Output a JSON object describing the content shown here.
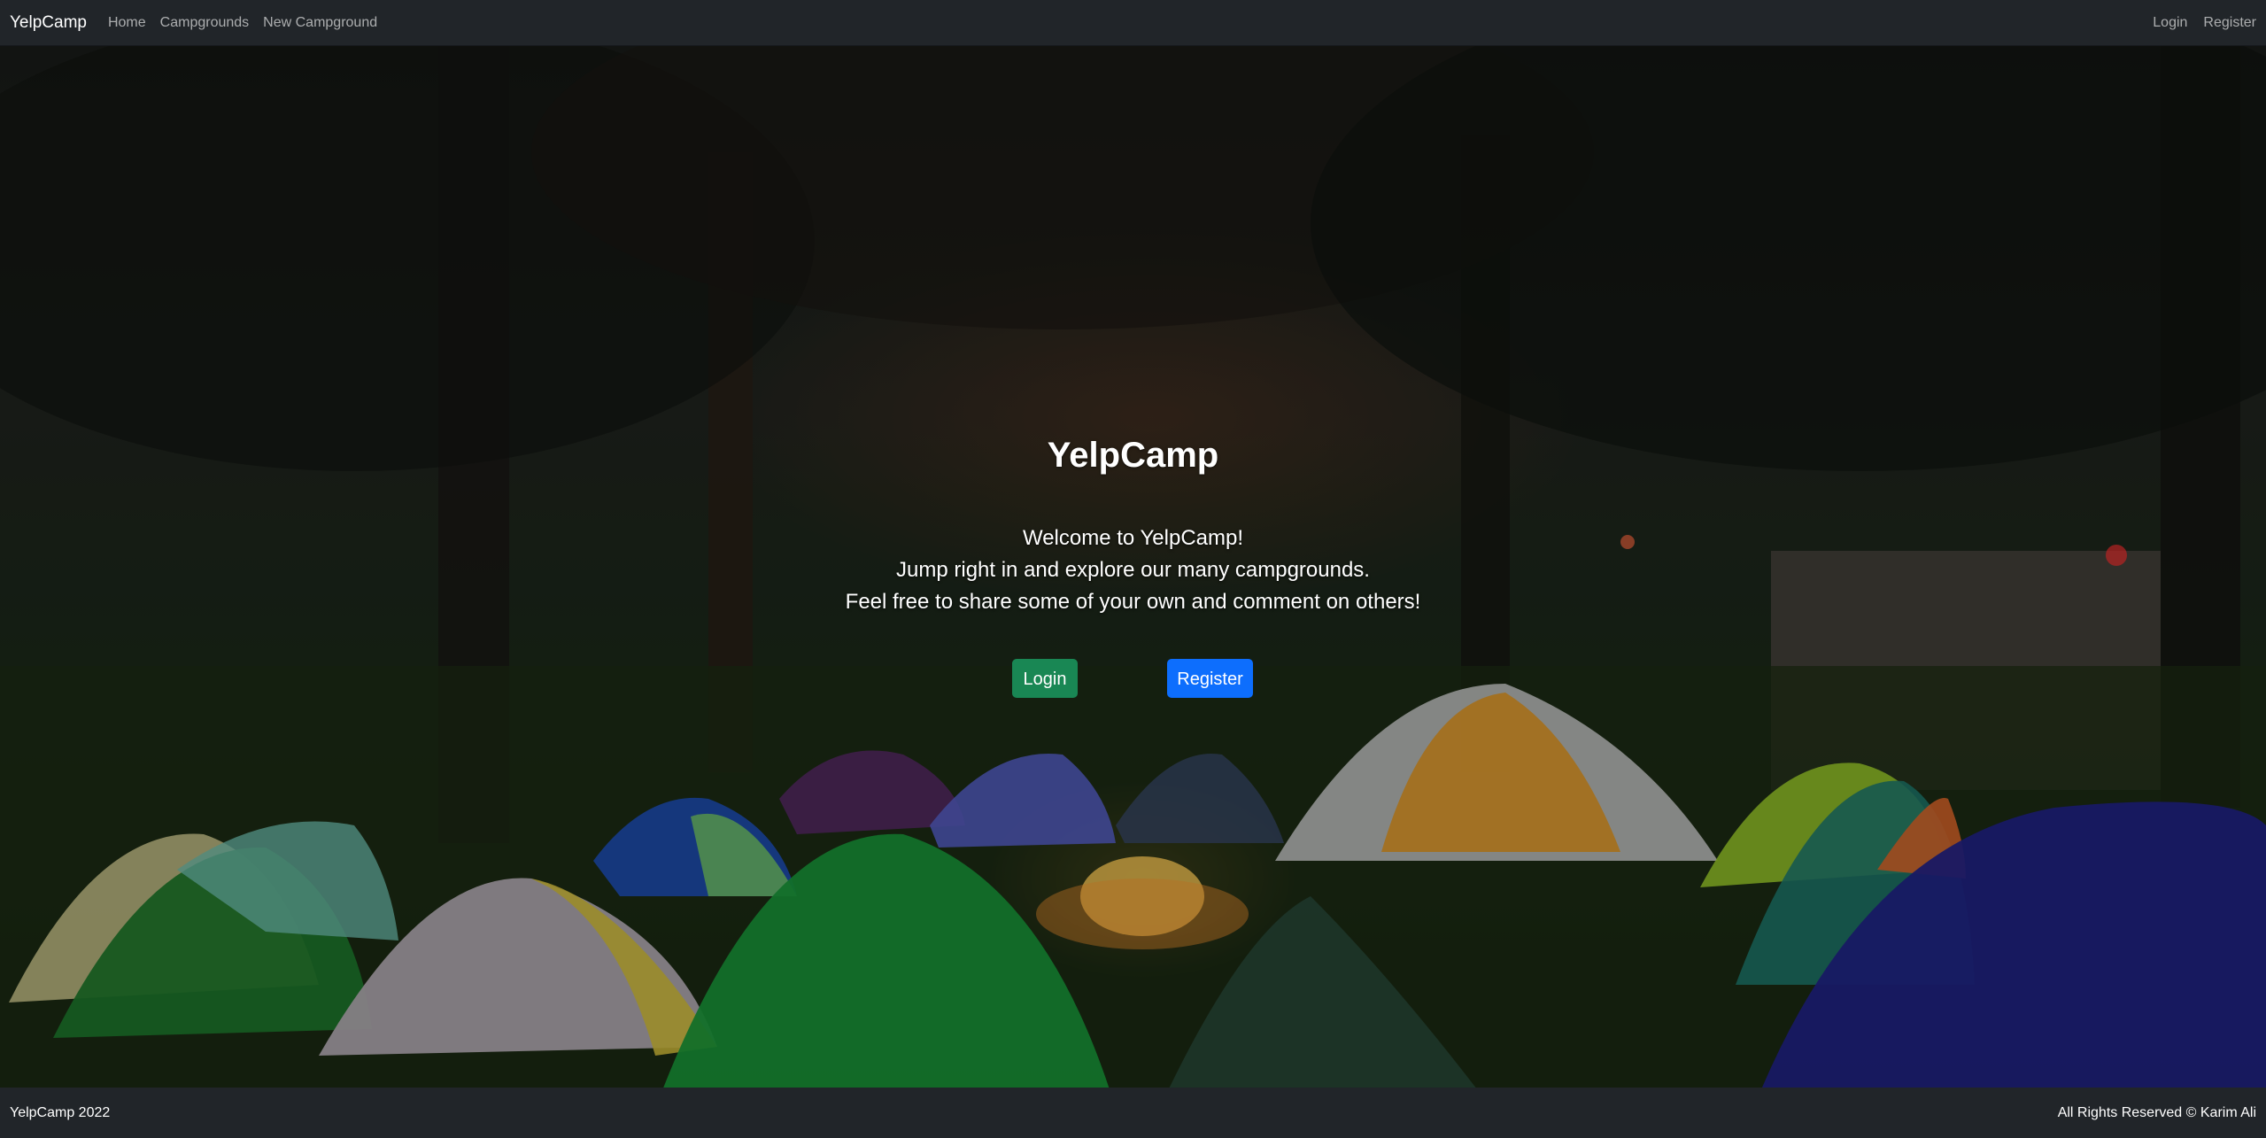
{
  "navbar": {
    "brand": "YelpCamp",
    "links": [
      "Home",
      "Campgrounds",
      "New Campground"
    ],
    "login": "Login",
    "register": "Register"
  },
  "hero": {
    "title": "YelpCamp",
    "lines": [
      "Welcome to YelpCamp!",
      "Jump right in and explore our many campgrounds.",
      "Feel free to share some of your own and comment on others!"
    ],
    "login_button": "Login",
    "register_button": "Register"
  },
  "footer": {
    "left": "YelpCamp 2022",
    "right": "All Rights Reserved © Karim Ali"
  },
  "colors": {
    "navbar_bg": "#212529",
    "login_green": "#198754",
    "register_blue": "#0d6efd"
  }
}
